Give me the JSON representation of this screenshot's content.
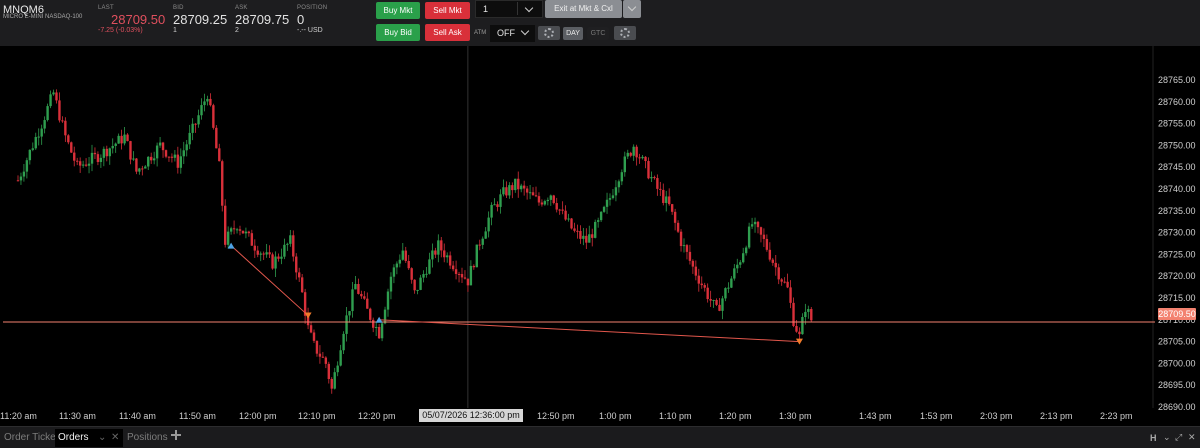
{
  "instrument": {
    "symbol": "MNQM6",
    "description": "MICRO E-MINI NASDAQ-100"
  },
  "quote": {
    "last_label": "LAST",
    "last": "28709.50",
    "change": "-7.25 (-0.03%)",
    "bid_label": "BID",
    "bid": "28709.25",
    "bid_size": "1",
    "ask_label": "ASK",
    "ask": "28709.75",
    "ask_size": "2",
    "position_label": "POSITION",
    "position": "0",
    "position_pnl": "-.-- USD"
  },
  "order_entry": {
    "buy_mkt": "Buy Mkt",
    "sell_mkt": "Sell Mkt",
    "buy_bid": "Buy Bid",
    "sell_ask": "Sell Ask",
    "quantity": "1",
    "exit_button": "Exit at Mkt & Cxl",
    "atm_label": "ATM",
    "atm_value": "OFF",
    "tif_day": "DAY",
    "tif_gtc": "GTC"
  },
  "chart": {
    "cursor_label": "05/07/2026 12:36:00 pm",
    "last_price_tag": "28709.50",
    "y_ticks": [
      "28765.00",
      "28760.00",
      "28755.00",
      "28750.00",
      "28745.00",
      "28740.00",
      "28735.00",
      "28730.00",
      "28725.00",
      "28720.00",
      "28715.00",
      "28710.00",
      "28705.00",
      "28700.00",
      "28695.00",
      "28690.00"
    ],
    "x_ticks": [
      "11:20 am",
      "11:30 am",
      "11:40 am",
      "11:50 am",
      "12:00 pm",
      "12:10 pm",
      "12:20 pm",
      "12:50 pm",
      "1:00 pm",
      "1:10 pm",
      "1:20 pm",
      "1:30 pm",
      "1:43 pm",
      "1:53 pm",
      "2:03 pm",
      "2:13 pm",
      "2:23 pm"
    ]
  },
  "chart_data": {
    "type": "candlestick",
    "instrument": "MNQM6",
    "ylim": [
      28688,
      28768
    ],
    "price_line": 28709.5,
    "cursor_time": "12:36 pm",
    "path_1120_to_1334": [
      [
        "11:20 am",
        28742
      ],
      [
        "11:24 am",
        28755
      ],
      [
        "11:26 am",
        28762
      ],
      [
        "11:28 am",
        28752
      ],
      [
        "11:30 am",
        28745
      ],
      [
        "11:34 am",
        28748
      ],
      [
        "11:38 am",
        28752
      ],
      [
        "11:40 am",
        28744
      ],
      [
        "11:44 am",
        28750
      ],
      [
        "11:47 am",
        28746
      ],
      [
        "11:50 am",
        28755
      ],
      [
        "11:52 am",
        28762
      ],
      [
        "11:54 am",
        28745
      ],
      [
        "11:55 am",
        28728
      ],
      [
        "11:57 am",
        28732
      ],
      [
        "12:00 pm",
        28727
      ],
      [
        "12:03 pm",
        28723
      ],
      [
        "12:06 pm",
        28728
      ],
      [
        "12:08 pm",
        28716
      ],
      [
        "12:09 pm",
        28708
      ],
      [
        "12:10 pm",
        28704
      ],
      [
        "12:12 pm",
        28700
      ],
      [
        "12:13 pm",
        28694
      ],
      [
        "12:15 pm",
        28708
      ],
      [
        "12:17 pm",
        28718
      ],
      [
        "12:19 pm",
        28712
      ],
      [
        "12:21 pm",
        28707
      ],
      [
        "12:23 pm",
        28720
      ],
      [
        "12:25 pm",
        28726
      ],
      [
        "12:27 pm",
        28716
      ],
      [
        "12:29 pm",
        28722
      ],
      [
        "12:31 pm",
        28727
      ],
      [
        "12:34 pm",
        28722
      ],
      [
        "12:36 pm",
        28719
      ],
      [
        "12:38 pm",
        28728
      ],
      [
        "12:40 pm",
        28735
      ],
      [
        "12:42 pm",
        28739
      ],
      [
        "12:44 pm",
        28741
      ],
      [
        "12:46 pm",
        28739
      ],
      [
        "12:48 pm",
        28737
      ],
      [
        "12:50 pm",
        28739
      ],
      [
        "12:52 pm",
        28734
      ],
      [
        "12:54 pm",
        28730
      ],
      [
        "12:56 pm",
        28728
      ],
      [
        "12:58 pm",
        28732
      ],
      [
        "1:00 pm",
        28738
      ],
      [
        "1:02 pm",
        28745
      ],
      [
        "1:04 pm",
        28750
      ],
      [
        "1:06 pm",
        28745
      ],
      [
        "1:08 pm",
        28740
      ],
      [
        "1:10 pm",
        28736
      ],
      [
        "1:12 pm",
        28728
      ],
      [
        "1:14 pm",
        28722
      ],
      [
        "1:16 pm",
        28717
      ],
      [
        "1:18 pm",
        28712
      ],
      [
        "1:20 pm",
        28718
      ],
      [
        "1:22 pm",
        28724
      ],
      [
        "1:24 pm",
        28732
      ],
      [
        "1:26 pm",
        28728
      ],
      [
        "1:28 pm",
        28722
      ],
      [
        "1:30 pm",
        28717
      ],
      [
        "1:31 pm",
        28710
      ],
      [
        "1:32 pm",
        28706
      ],
      [
        "1:33 pm",
        28713
      ],
      [
        "1:34 pm",
        28710
      ]
    ],
    "trades": [
      {
        "side": "buy",
        "time": "11:56 am",
        "price": 28727
      },
      {
        "side": "sell",
        "time": "12:09 pm",
        "price": 28711
      },
      {
        "side": "buy",
        "time": "12:21 pm",
        "price": 28710
      },
      {
        "side": "sell",
        "time": "1:32 pm",
        "price": 28705
      }
    ]
  }
}
